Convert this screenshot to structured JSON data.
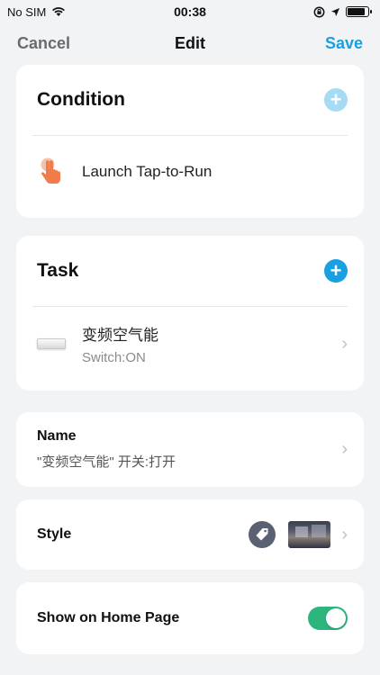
{
  "status_bar": {
    "carrier": "No SIM",
    "time": "00:38"
  },
  "nav": {
    "cancel": "Cancel",
    "title": "Edit",
    "save": "Save"
  },
  "condition": {
    "title": "Condition",
    "add_color": "#a6dcf3",
    "item_label": "Launch Tap-to-Run"
  },
  "task": {
    "title": "Task",
    "add_color": "#1a9fe0",
    "item_name": "变频空气能",
    "item_state": "Switch:ON"
  },
  "name": {
    "label": "Name",
    "value": "\"变频空气能\" 开关:打开"
  },
  "style": {
    "label": "Style"
  },
  "home": {
    "label": "Show on Home Page",
    "toggle_on": true,
    "toggle_color": "#2cb67d"
  },
  "colors": {
    "accent": "#1a9fe0",
    "background": "#f2f3f5"
  }
}
